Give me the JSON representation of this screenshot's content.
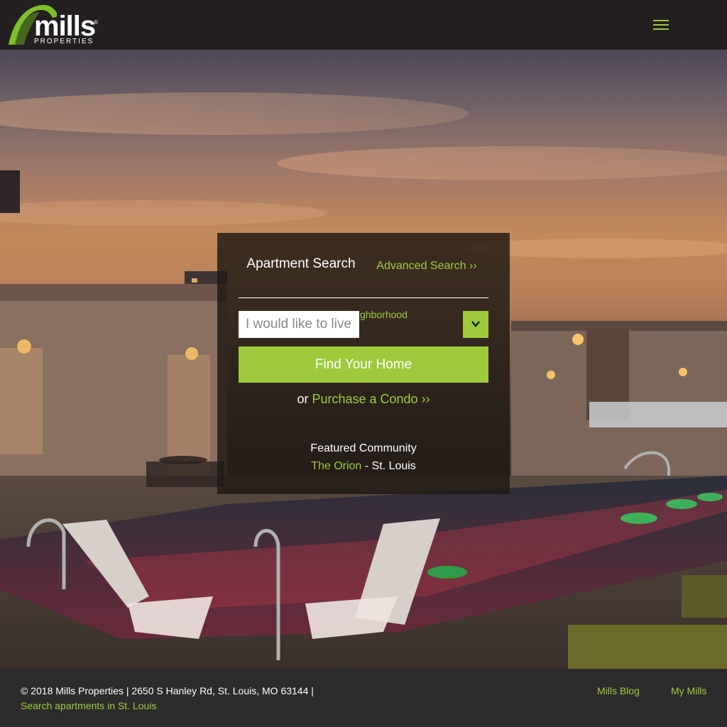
{
  "header": {
    "logo_text": "mills",
    "logo_registered": "®",
    "logo_subtext": "PROPERTIES",
    "menu_icon": "hamburger-menu-icon"
  },
  "search": {
    "tab_title": "Apartment Search",
    "advanced_link": "Advanced Search ››",
    "neighborhood_label": "Neighborhood",
    "input_placeholder": "I would like to live in...",
    "dropdown_icon": "chevron-down-icon",
    "find_button": "Find Your Home",
    "condo_prefix": "or",
    "condo_link": "Purchase a Condo ››",
    "featured_label": "Featured Community",
    "featured_name": "The Orion",
    "featured_location": " - St. Louis"
  },
  "footer": {
    "copyright": "© 2018 Mills Properties | 2650 S Hanley Rd, St. Louis, MO 63144 |",
    "search_link": "Search apartments in St. Louis",
    "blog_link": "Mills Blog",
    "my_mills_link": "My Mills"
  },
  "colors": {
    "accent": "#9ecb3b",
    "header_bg": "#231f20",
    "footer_bg": "#2d2b2c"
  }
}
